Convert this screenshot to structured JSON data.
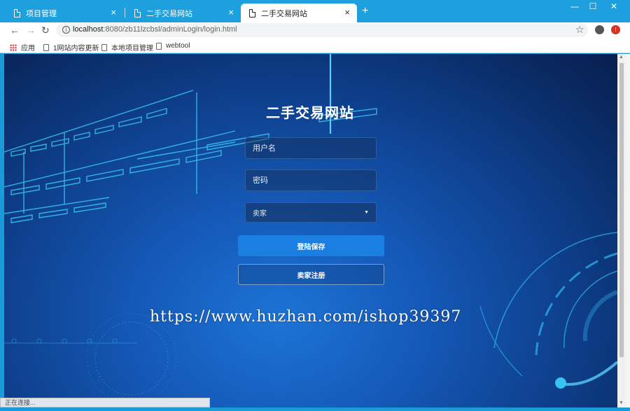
{
  "browser": {
    "tabs": [
      {
        "label": "项目管理",
        "close": "×"
      },
      {
        "label": "二手交易网站",
        "close": "×"
      },
      {
        "label": "二手交易网站",
        "close": "×"
      }
    ],
    "new_tab": "+",
    "window_controls": {
      "minimize": "—",
      "maximize": "☐",
      "close": "✕"
    },
    "nav": {
      "back": "←",
      "forward": "→",
      "reload": "↻"
    },
    "url_host": "localhost",
    "url_rest": ":8080/zb11lzcbsl/adminLogin/login.html",
    "info": "i",
    "star": "☆",
    "ext": "!"
  },
  "bookmarks": [
    {
      "label": "应用"
    },
    {
      "label": "1网站内容更新"
    },
    {
      "label": "本地项目管理"
    },
    {
      "label": "webtool"
    }
  ],
  "login": {
    "title": "二手交易网站",
    "username_placeholder": "用户名",
    "password_placeholder": "密码",
    "role_selected": "卖家",
    "role_caret": "▼",
    "login_button": "登陆保存",
    "register_button": "卖家注册"
  },
  "watermark": "https://www.huzhan.com/ishop39397",
  "status_text": "正在连接...",
  "scroll": {
    "up": "▲",
    "down": "▼"
  },
  "colors": {
    "chrome_blue": "#1fa0de",
    "primary_button": "#1a7fe0"
  }
}
